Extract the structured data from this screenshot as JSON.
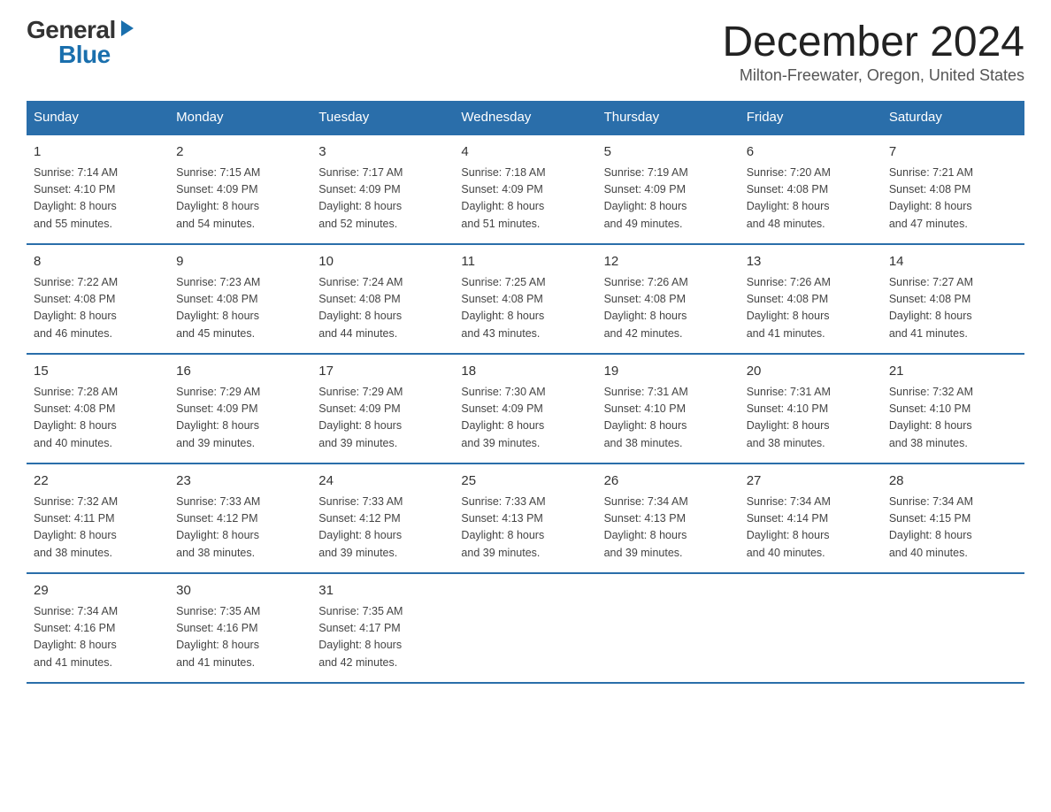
{
  "logo": {
    "general": "General",
    "blue": "Blue",
    "arrow": "▶"
  },
  "title": "December 2024",
  "location": "Milton-Freewater, Oregon, United States",
  "headers": [
    "Sunday",
    "Monday",
    "Tuesday",
    "Wednesday",
    "Thursday",
    "Friday",
    "Saturday"
  ],
  "weeks": [
    [
      {
        "day": "1",
        "info": "Sunrise: 7:14 AM\nSunset: 4:10 PM\nDaylight: 8 hours\nand 55 minutes."
      },
      {
        "day": "2",
        "info": "Sunrise: 7:15 AM\nSunset: 4:09 PM\nDaylight: 8 hours\nand 54 minutes."
      },
      {
        "day": "3",
        "info": "Sunrise: 7:17 AM\nSunset: 4:09 PM\nDaylight: 8 hours\nand 52 minutes."
      },
      {
        "day": "4",
        "info": "Sunrise: 7:18 AM\nSunset: 4:09 PM\nDaylight: 8 hours\nand 51 minutes."
      },
      {
        "day": "5",
        "info": "Sunrise: 7:19 AM\nSunset: 4:09 PM\nDaylight: 8 hours\nand 49 minutes."
      },
      {
        "day": "6",
        "info": "Sunrise: 7:20 AM\nSunset: 4:08 PM\nDaylight: 8 hours\nand 48 minutes."
      },
      {
        "day": "7",
        "info": "Sunrise: 7:21 AM\nSunset: 4:08 PM\nDaylight: 8 hours\nand 47 minutes."
      }
    ],
    [
      {
        "day": "8",
        "info": "Sunrise: 7:22 AM\nSunset: 4:08 PM\nDaylight: 8 hours\nand 46 minutes."
      },
      {
        "day": "9",
        "info": "Sunrise: 7:23 AM\nSunset: 4:08 PM\nDaylight: 8 hours\nand 45 minutes."
      },
      {
        "day": "10",
        "info": "Sunrise: 7:24 AM\nSunset: 4:08 PM\nDaylight: 8 hours\nand 44 minutes."
      },
      {
        "day": "11",
        "info": "Sunrise: 7:25 AM\nSunset: 4:08 PM\nDaylight: 8 hours\nand 43 minutes."
      },
      {
        "day": "12",
        "info": "Sunrise: 7:26 AM\nSunset: 4:08 PM\nDaylight: 8 hours\nand 42 minutes."
      },
      {
        "day": "13",
        "info": "Sunrise: 7:26 AM\nSunset: 4:08 PM\nDaylight: 8 hours\nand 41 minutes."
      },
      {
        "day": "14",
        "info": "Sunrise: 7:27 AM\nSunset: 4:08 PM\nDaylight: 8 hours\nand 41 minutes."
      }
    ],
    [
      {
        "day": "15",
        "info": "Sunrise: 7:28 AM\nSunset: 4:08 PM\nDaylight: 8 hours\nand 40 minutes."
      },
      {
        "day": "16",
        "info": "Sunrise: 7:29 AM\nSunset: 4:09 PM\nDaylight: 8 hours\nand 39 minutes."
      },
      {
        "day": "17",
        "info": "Sunrise: 7:29 AM\nSunset: 4:09 PM\nDaylight: 8 hours\nand 39 minutes."
      },
      {
        "day": "18",
        "info": "Sunrise: 7:30 AM\nSunset: 4:09 PM\nDaylight: 8 hours\nand 39 minutes."
      },
      {
        "day": "19",
        "info": "Sunrise: 7:31 AM\nSunset: 4:10 PM\nDaylight: 8 hours\nand 38 minutes."
      },
      {
        "day": "20",
        "info": "Sunrise: 7:31 AM\nSunset: 4:10 PM\nDaylight: 8 hours\nand 38 minutes."
      },
      {
        "day": "21",
        "info": "Sunrise: 7:32 AM\nSunset: 4:10 PM\nDaylight: 8 hours\nand 38 minutes."
      }
    ],
    [
      {
        "day": "22",
        "info": "Sunrise: 7:32 AM\nSunset: 4:11 PM\nDaylight: 8 hours\nand 38 minutes."
      },
      {
        "day": "23",
        "info": "Sunrise: 7:33 AM\nSunset: 4:12 PM\nDaylight: 8 hours\nand 38 minutes."
      },
      {
        "day": "24",
        "info": "Sunrise: 7:33 AM\nSunset: 4:12 PM\nDaylight: 8 hours\nand 39 minutes."
      },
      {
        "day": "25",
        "info": "Sunrise: 7:33 AM\nSunset: 4:13 PM\nDaylight: 8 hours\nand 39 minutes."
      },
      {
        "day": "26",
        "info": "Sunrise: 7:34 AM\nSunset: 4:13 PM\nDaylight: 8 hours\nand 39 minutes."
      },
      {
        "day": "27",
        "info": "Sunrise: 7:34 AM\nSunset: 4:14 PM\nDaylight: 8 hours\nand 40 minutes."
      },
      {
        "day": "28",
        "info": "Sunrise: 7:34 AM\nSunset: 4:15 PM\nDaylight: 8 hours\nand 40 minutes."
      }
    ],
    [
      {
        "day": "29",
        "info": "Sunrise: 7:34 AM\nSunset: 4:16 PM\nDaylight: 8 hours\nand 41 minutes."
      },
      {
        "day": "30",
        "info": "Sunrise: 7:35 AM\nSunset: 4:16 PM\nDaylight: 8 hours\nand 41 minutes."
      },
      {
        "day": "31",
        "info": "Sunrise: 7:35 AM\nSunset: 4:17 PM\nDaylight: 8 hours\nand 42 minutes."
      },
      {
        "day": "",
        "info": ""
      },
      {
        "day": "",
        "info": ""
      },
      {
        "day": "",
        "info": ""
      },
      {
        "day": "",
        "info": ""
      }
    ]
  ]
}
